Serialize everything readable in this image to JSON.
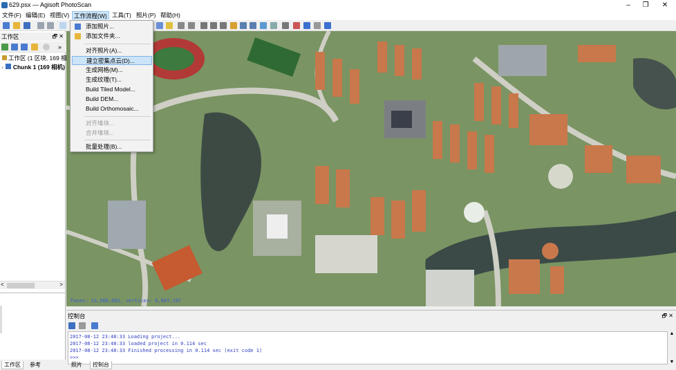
{
  "window": {
    "title": "629.psx — Agisoft PhotoScan",
    "minimize": "–",
    "maximize": "❐",
    "close": "✕"
  },
  "menubar": [
    {
      "label": "文件(F)"
    },
    {
      "label": "编辑(E)"
    },
    {
      "label": "视图(V)"
    },
    {
      "label": "工作流程(W)"
    },
    {
      "label": "工具(T)"
    },
    {
      "label": "照片(P)"
    },
    {
      "label": "帮助(H)"
    }
  ],
  "workflow_menu": {
    "items": [
      {
        "label": "添加照片...",
        "icon": "add-photos-icon"
      },
      {
        "label": "添加文件夹...",
        "icon": "add-folder-icon"
      },
      {
        "label": "对齐照片(A)..."
      },
      {
        "label": "建立密集点云(D)...",
        "highlighted": true
      },
      {
        "label": "生成网格(M)..."
      },
      {
        "label": "生成纹理(T)..."
      },
      {
        "label": "Build Tiled Model..."
      },
      {
        "label": "Build DEM..."
      },
      {
        "label": "Build Orthomosaic..."
      },
      {
        "label": "对齐堆块...",
        "disabled": true
      },
      {
        "label": "合并堆块...",
        "disabled": true
      },
      {
        "label": "批量处理(B)..."
      }
    ]
  },
  "workspace": {
    "header": "工作区",
    "header_controls": "🗗 ✕",
    "tree": [
      {
        "label": "工作区 (1 区块, 169 相机)"
      },
      {
        "label": "Chunk 1 (169 相机)"
      }
    ],
    "scroll_left": "<",
    "scroll_right": ">",
    "tabs": [
      "工作区",
      "参考"
    ]
  },
  "viewport": {
    "status": "Faces: 13,566,682, vertices: 6,807,197"
  },
  "console": {
    "header": "控制台",
    "header_controls": "🗗 ✕",
    "lines": [
      "2017-08-12 23:48:33 Loading project...",
      "2017-08-12 23:48:33 loaded project in 0.114 sec",
      "2017-08-12 23:48:33 Finished processing in 0.114 sec (exit code 1)",
      ">>>"
    ],
    "scroll_up": "▲",
    "scroll_down": "▼"
  },
  "bottom_tabs": [
    "照片",
    "控制台"
  ],
  "colors": {
    "menu_highlight": "#cce4f7",
    "console_text": "#2f3fbf",
    "accent": "#2b6cb0"
  }
}
